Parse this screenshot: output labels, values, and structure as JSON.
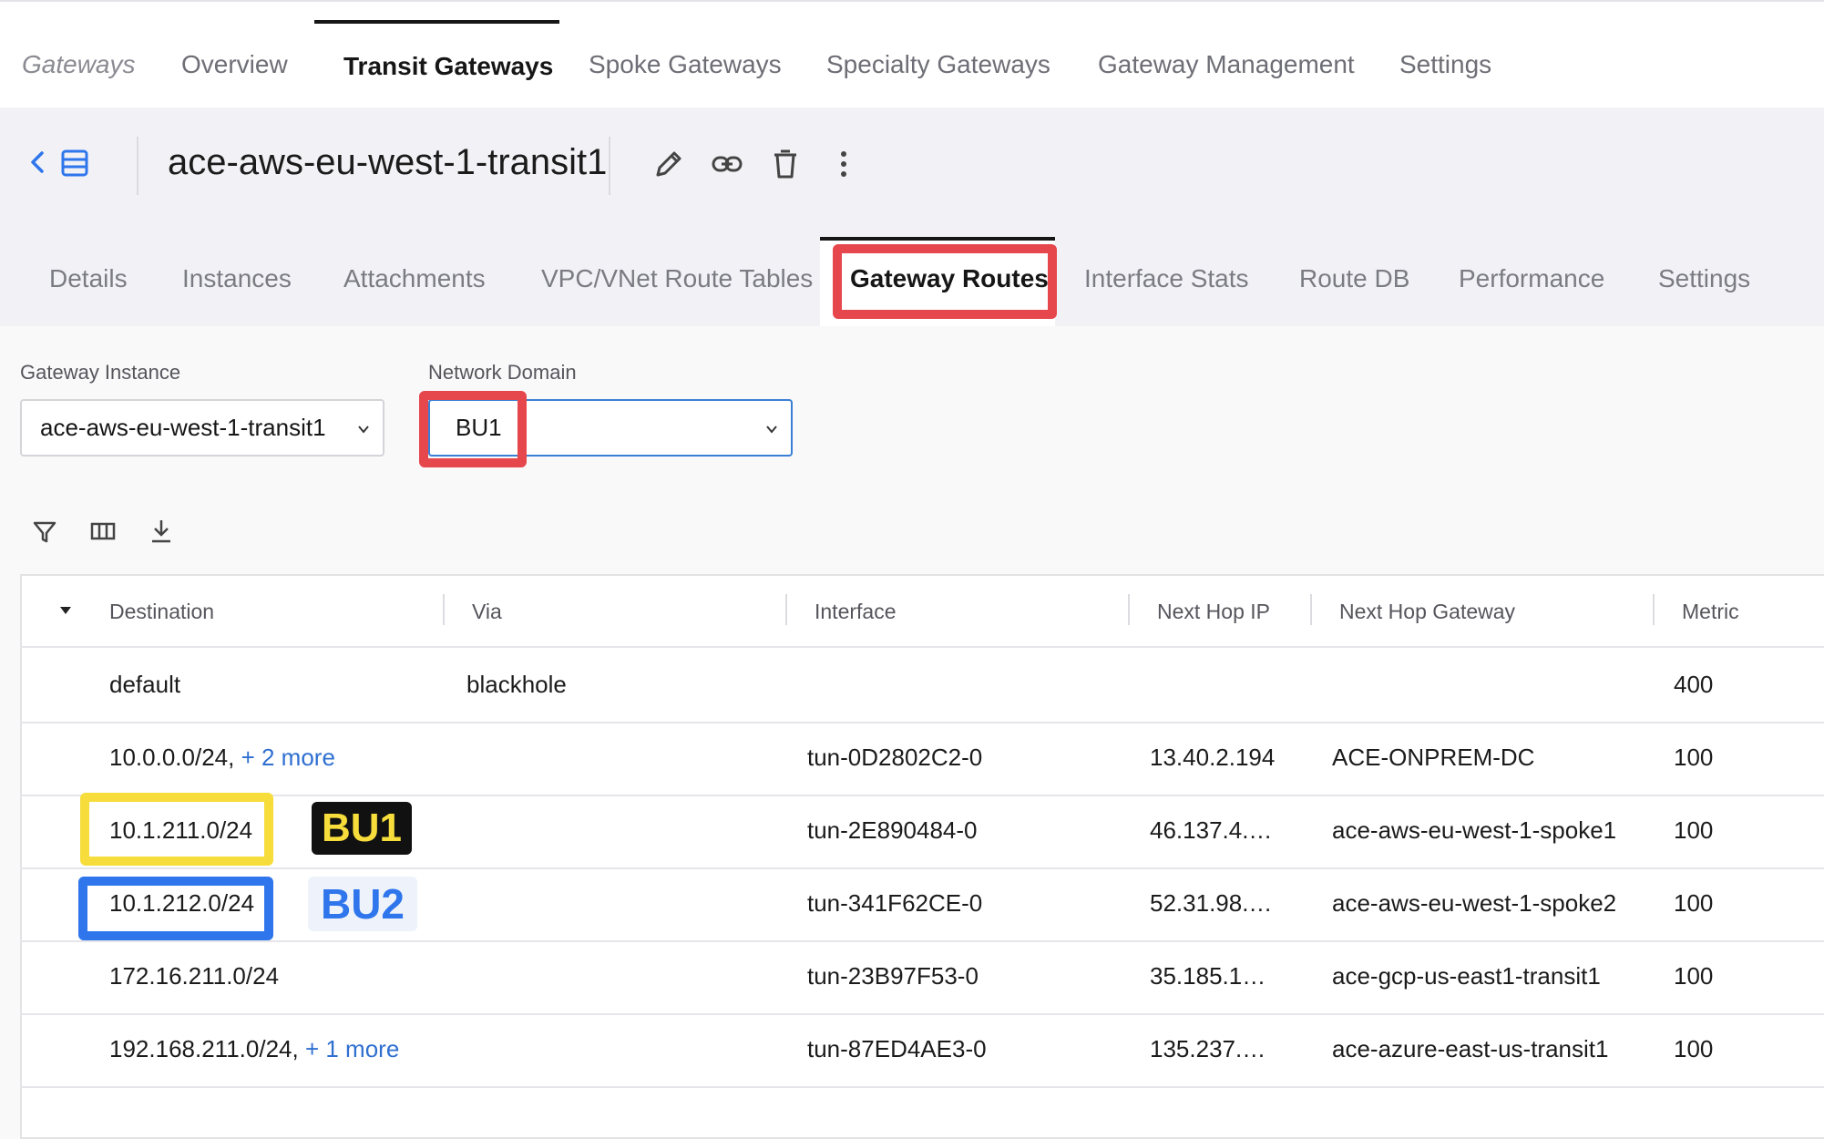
{
  "topnav": {
    "tabs": [
      {
        "label": "Gateways"
      },
      {
        "label": "Overview"
      },
      {
        "label": "Transit Gateways"
      },
      {
        "label": "Spoke Gateways"
      },
      {
        "label": "Specialty Gateways"
      },
      {
        "label": "Gateway Management"
      },
      {
        "label": "Settings"
      }
    ],
    "active": "Transit Gateways"
  },
  "header": {
    "title": "ace-aws-eu-west-1-transit1",
    "icons": [
      "back-chevron-icon",
      "list-view-icon",
      "edit-pencil-icon",
      "link-icon",
      "trash-icon",
      "more-vertical-icon"
    ]
  },
  "subtabs": {
    "tabs": [
      {
        "label": "Details"
      },
      {
        "label": "Instances"
      },
      {
        "label": "Attachments"
      },
      {
        "label": "VPC/VNet Route Tables"
      },
      {
        "label": "Gateway Routes"
      },
      {
        "label": "Interface Stats"
      },
      {
        "label": "Route DB"
      },
      {
        "label": "Performance"
      },
      {
        "label": "Settings"
      }
    ],
    "active": "Gateway Routes"
  },
  "filters": {
    "gateway_instance": {
      "label": "Gateway Instance",
      "value": "ace-aws-eu-west-1-transit1"
    },
    "network_domain": {
      "label": "Network Domain",
      "value": "BU1"
    }
  },
  "toolbar": {
    "icons": [
      "filter-icon",
      "columns-icon",
      "download-icon"
    ]
  },
  "table": {
    "headers": {
      "destination": "Destination",
      "via": "Via",
      "interface": "Interface",
      "next_hop_ip": "Next Hop IP",
      "next_hop_gateway": "Next Hop Gateway",
      "metric": "Metric"
    },
    "rows": [
      {
        "destination": "default",
        "more": "",
        "via": "blackhole",
        "interface": "",
        "next_hop_ip": "",
        "next_hop_gateway": "",
        "metric": "400"
      },
      {
        "destination": "10.0.0.0/24,",
        "more": "+ 2 more",
        "via": "",
        "interface": "tun-0D2802C2-0",
        "next_hop_ip": "13.40.2.194",
        "next_hop_gateway": "ACE-ONPREM-DC",
        "metric": "100"
      },
      {
        "destination": "10.1.211.0/24",
        "more": "",
        "via": "",
        "interface": "tun-2E890484-0",
        "next_hop_ip": "46.137.4.…",
        "next_hop_gateway": "ace-aws-eu-west-1-spoke1",
        "metric": "100"
      },
      {
        "destination": "10.1.212.0/24",
        "more": "",
        "via": "",
        "interface": "tun-341F62CE-0",
        "next_hop_ip": "52.31.98.…",
        "next_hop_gateway": "ace-aws-eu-west-1-spoke2",
        "metric": "100"
      },
      {
        "destination": "172.16.211.0/24",
        "more": "",
        "via": "",
        "interface": "tun-23B97F53-0",
        "next_hop_ip": "35.185.1…",
        "next_hop_gateway": "ace-gcp-us-east1-transit1",
        "metric": "100"
      },
      {
        "destination": "192.168.211.0/24,",
        "more": "+ 1 more",
        "via": "",
        "interface": "tun-87ED4AE3-0",
        "next_hop_ip": "135.237.…",
        "next_hop_gateway": "ace-azure-east-us-transit1",
        "metric": "100"
      }
    ]
  },
  "annotations": {
    "bu1_tag": "BU1",
    "bu2_tag": "BU2",
    "colors": {
      "red": "#e5474c",
      "yellow": "#f6dd3b",
      "blue": "#2f76ec"
    }
  }
}
